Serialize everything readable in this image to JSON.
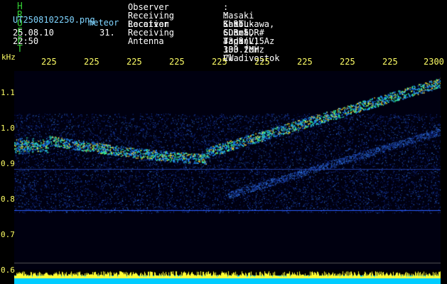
{
  "header": {
    "app_name": "H R O F F T",
    "filename": "UT2508102250.png",
    "meteor_label": "meteor",
    "timestamp": "25.08.10 22:50",
    "count": "31.",
    "fields": [
      {
        "label": "Observer",
        "value": "Masaki Kano"
      },
      {
        "label": "Receiving Location",
        "value": "Shibukawa, Gunma, Japan"
      },
      {
        "label": "Receiver",
        "value": "RTL-SDR SDR# 43dB L15 103.2MHz CW"
      },
      {
        "label": "Receiving Antenna",
        "value": "3el Yagi(V) Az 330 for Vladivostok"
      }
    ],
    "separator": ":"
  },
  "axis": {
    "y_unit": "kHz",
    "y_ticks": [
      "1.1",
      "1.0",
      "0.9",
      "0.8",
      "0.7",
      "0.6"
    ],
    "x_ticks": [
      "225",
      "225",
      "225",
      "225",
      "225",
      "225",
      "225",
      "225",
      "225",
      "2300"
    ]
  },
  "colors": {
    "background": "#000000",
    "green": "#33cc33",
    "cyan": "#7fd4ff",
    "yellow": "#ffff66",
    "signal_low": "#0a1a8a",
    "signal_mid": "#1e6cff",
    "signal_high": "#ffdd33"
  }
}
